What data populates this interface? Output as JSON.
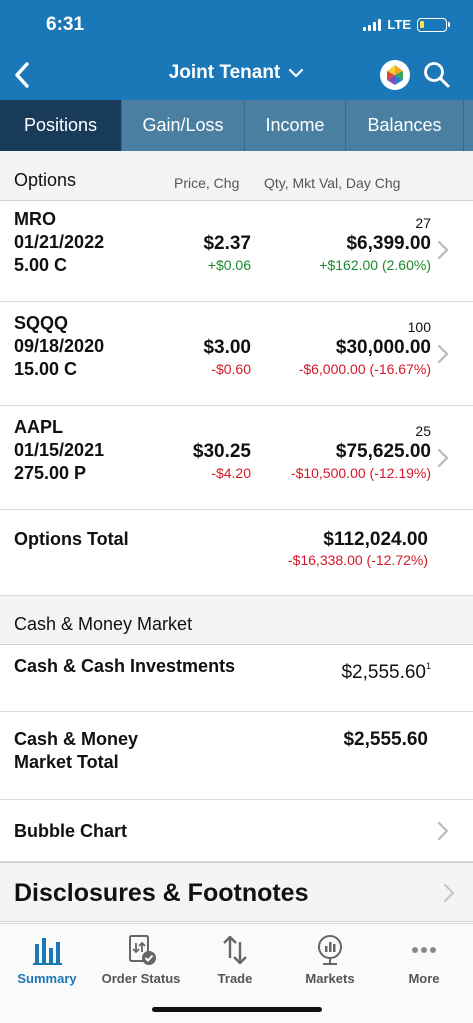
{
  "status_bar": {
    "time": "6:31",
    "network": "LTE",
    "battery_level": 0.15,
    "battery_color": "#ffe14a"
  },
  "header": {
    "title": "Joint Tenant",
    "accent_color": "#1b78b8"
  },
  "tabs": [
    {
      "label": "Positions",
      "active": true
    },
    {
      "label": "Gain/Loss",
      "active": false
    },
    {
      "label": "Income",
      "active": false
    },
    {
      "label": "Balances",
      "active": false
    }
  ],
  "options_section": {
    "label": "Options",
    "col_price": "Price, Chg",
    "col_values": "Qty, Mkt Val, Day Chg",
    "rows": [
      {
        "symbol": "MRO",
        "expiry": "01/21/2022",
        "strike": "5.00 C",
        "price": "$2.37",
        "price_chg": "+$0.06",
        "qty": "27",
        "mkt_val": "$6,399.00",
        "day_chg": "+$162.00 (2.60%)",
        "direction": "up"
      },
      {
        "symbol": "SQQQ",
        "expiry": "09/18/2020",
        "strike": "15.00 C",
        "price": "$3.00",
        "price_chg": "-$0.60",
        "qty": "100",
        "mkt_val": "$30,000.00",
        "day_chg": "-$6,000.00 (-16.67%)",
        "direction": "down"
      },
      {
        "symbol": "AAPL",
        "expiry": "01/15/2021",
        "strike": "275.00 P",
        "price": "$30.25",
        "price_chg": "-$4.20",
        "qty": "25",
        "mkt_val": "$75,625.00",
        "day_chg": "-$10,500.00 (-12.19%)",
        "direction": "down"
      }
    ],
    "total_label": "Options Total",
    "total_value": "$112,024.00",
    "total_chg": "-$16,338.00 (-12.72%)"
  },
  "cash_section": {
    "label": "Cash & Money Market",
    "row_label": "Cash & Cash Investments",
    "row_value": "$2,555.60",
    "footnote_mark": "1",
    "total_label_line1": "Cash & Money",
    "total_label_line2": "Market Total",
    "total_value": "$2,555.60"
  },
  "bubble_chart": {
    "label": "Bubble Chart"
  },
  "disclosures": {
    "label": "Disclosures & Footnotes"
  },
  "bottom_nav": [
    {
      "label": "Summary",
      "icon": "bar-chart-icon",
      "active": true
    },
    {
      "label": "Order Status",
      "icon": "order-status-icon",
      "active": false
    },
    {
      "label": "Trade",
      "icon": "trade-arrows-icon",
      "active": false
    },
    {
      "label": "Markets",
      "icon": "markets-globe-icon",
      "active": false
    },
    {
      "label": "More",
      "icon": "more-dots-icon",
      "active": false
    }
  ],
  "colors": {
    "positive": "#1a8a2a",
    "negative": "#d2192a",
    "active_tab": "#173b58",
    "tab_bar": "#4a7fa2"
  }
}
